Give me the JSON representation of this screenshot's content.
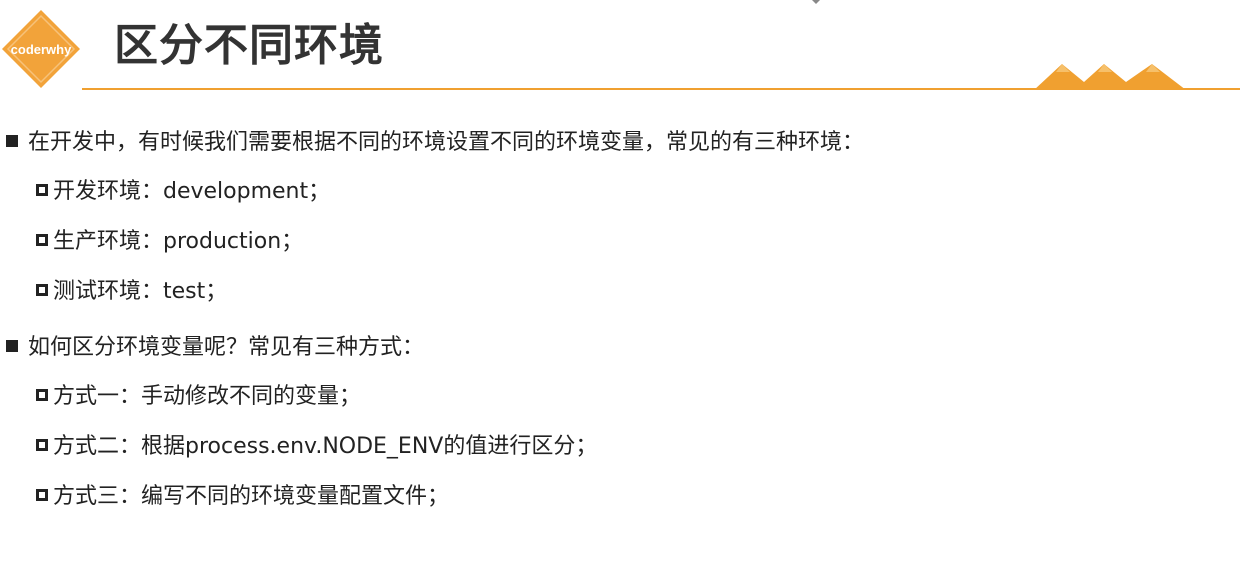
{
  "header": {
    "logo_text": "coderwhy",
    "title": "区分不同环境",
    "accent_color": "#f0a030",
    "logo_color": "#f2a33a"
  },
  "sections": [
    {
      "text": "在开发中，有时候我们需要根据不同的环境设置不同的环境变量，常见的有三种环境：",
      "items": [
        "开发环境：development；",
        "生产环境：production；",
        "测试环境：test；"
      ]
    },
    {
      "text": "如何区分环境变量呢？常见有三种方式：",
      "items": [
        "方式一：手动修改不同的变量；",
        "方式二：根据process.env.NODE_ENV的值进行区分；",
        "方式三：编写不同的环境变量配置文件；"
      ]
    }
  ]
}
